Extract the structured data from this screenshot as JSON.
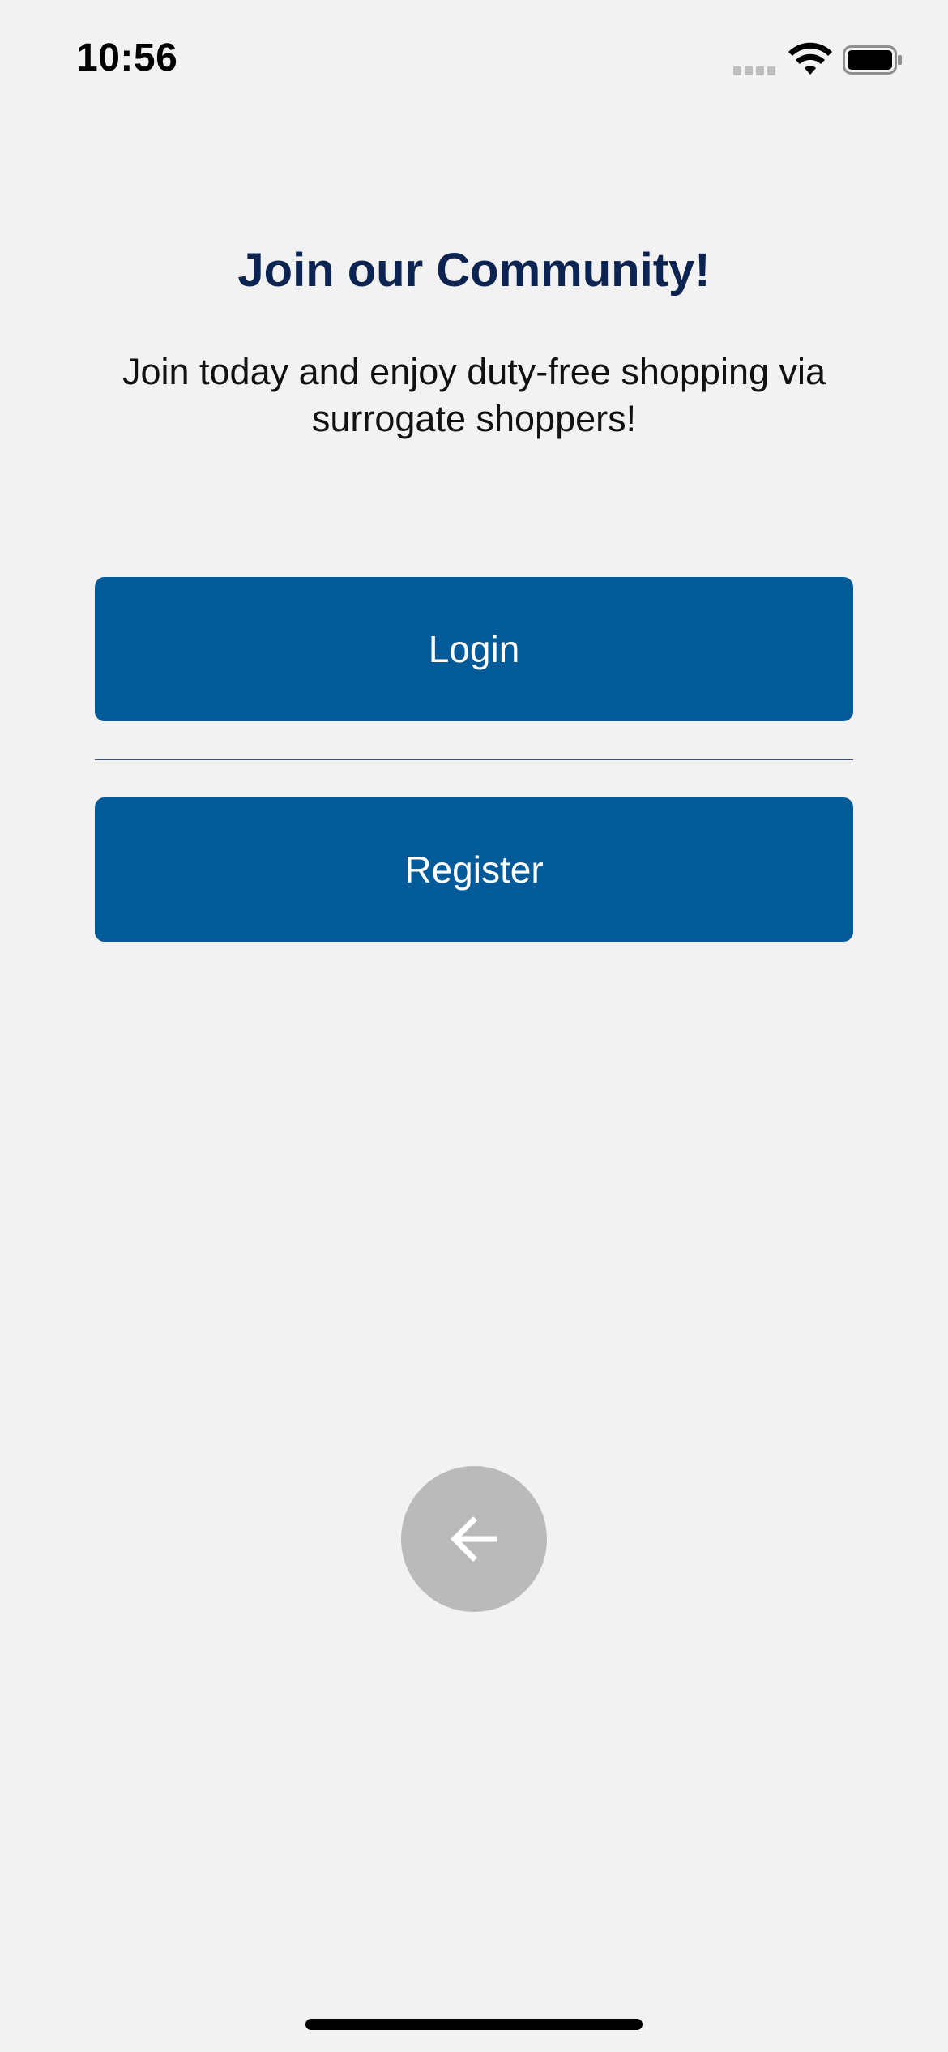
{
  "status_bar": {
    "time": "10:56",
    "icons": [
      "cellular-signal-icon",
      "wifi-icon",
      "battery-icon"
    ]
  },
  "main": {
    "title": "Join our Community!",
    "subtitle": "Join today and enjoy duty-free shopping via surrogate shoppers!",
    "login_label": "Login",
    "register_label": "Register"
  },
  "navigation": {
    "back_icon": "arrow-left-icon"
  },
  "colors": {
    "background": "#f2f2f2",
    "title": "#0c2451",
    "button": "#025b98",
    "button_text": "#ffffff",
    "back_button": "#bababa",
    "divider": "#4a5263"
  }
}
